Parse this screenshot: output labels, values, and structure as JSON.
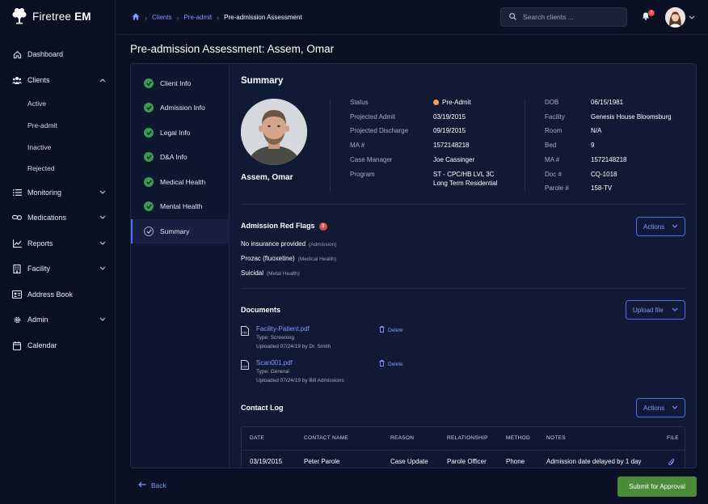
{
  "app": {
    "logo_text": "Firetree",
    "logo_bold": "EM"
  },
  "sidebar": {
    "items": [
      {
        "label": "Dashboard"
      },
      {
        "label": "Clients"
      },
      {
        "label": "Monitoring"
      },
      {
        "label": "Medications"
      },
      {
        "label": "Reports"
      },
      {
        "label": "Facility"
      },
      {
        "label": "Address Book"
      },
      {
        "label": "Admin"
      },
      {
        "label": "Calendar"
      }
    ],
    "client_sub": [
      {
        "label": "Active"
      },
      {
        "label": "Pre-admit"
      },
      {
        "label": "Inactive"
      },
      {
        "label": "Rejected"
      }
    ]
  },
  "breadcrumb": {
    "clients": "Clients",
    "preadmit": "Pre-admit",
    "current": "Pre-admission Assessment"
  },
  "search": {
    "placeholder": "Search clients ..."
  },
  "notifications": {
    "count": "2"
  },
  "page": {
    "title": "Pre-admission Assessment: Assem, Omar"
  },
  "steps": [
    {
      "label": "Client Info"
    },
    {
      "label": "Admission Info"
    },
    {
      "label": "Legal Info"
    },
    {
      "label": "D&A Info"
    },
    {
      "label": "Medical Health"
    },
    {
      "label": "Mental Health"
    },
    {
      "label": "Summary"
    }
  ],
  "summary": {
    "title": "Summary",
    "name": "Assem, Omar",
    "status_color": "#f0a04b",
    "left": [
      {
        "k": "Status",
        "v": "Pre-Admit"
      },
      {
        "k": "Projected Admit",
        "v": "03/19/2015"
      },
      {
        "k": "Projected Discharge",
        "v": "09/19/2015"
      },
      {
        "k": "MA #",
        "v": "1572148218"
      },
      {
        "k": "Case Manager",
        "v": "Joe Cassinger"
      },
      {
        "k": "Program",
        "v": "ST - CPC/HB LVL 3C",
        "v2": "Long Term Residential"
      }
    ],
    "right": [
      {
        "k": "DOB",
        "v": "06/15/1981"
      },
      {
        "k": "Facility",
        "v": "Genesis House Bloomsburg"
      },
      {
        "k": "Room",
        "v": "N/A"
      },
      {
        "k": "Bed",
        "v": "9"
      },
      {
        "k": "MA #",
        "v": "1572148218"
      },
      {
        "k": "Doc #",
        "v": "CQ-1018"
      },
      {
        "k": "Parole #",
        "v": "158-TV"
      }
    ]
  },
  "red_flags": {
    "title": "Admission Red Flags",
    "count": "3",
    "actions_label": "Actions",
    "items": [
      {
        "name": "No insurance provided",
        "category": "(Admission)"
      },
      {
        "name": "Prozac (fluoxetine)",
        "category": "(Medical Health)"
      },
      {
        "name": "Suicidal",
        "category": "(Metal Health)"
      }
    ]
  },
  "documents": {
    "title": "Documents",
    "upload_label": "Upload file",
    "delete_label": "Delete",
    "items": [
      {
        "name": "Facility-Patient.pdf",
        "type": "Type: Screening",
        "uploaded": "Uploaded 07/24/19 by Dr. Smith"
      },
      {
        "name": "Scan001.pdf",
        "type": "Type: General",
        "uploaded": "Uploaded 07/24/19 by Bill Admissions"
      }
    ]
  },
  "contact_log": {
    "title": "Contact Log",
    "actions_label": "Actions",
    "columns": [
      "DATE",
      "CONTACT NAME",
      "REASON",
      "RELATIONSHIP",
      "METHOD",
      "NOTES",
      "FILE"
    ],
    "rows": [
      {
        "date": "03/19/2015",
        "contact": "Peter Parole",
        "reason": "Case Update",
        "relationship": "Parole Officer",
        "method": "Phone",
        "notes": "Admission date delayed by 1 day"
      }
    ]
  },
  "footer": {
    "back_label": "Back",
    "submit_label": "Submit for Approval"
  }
}
